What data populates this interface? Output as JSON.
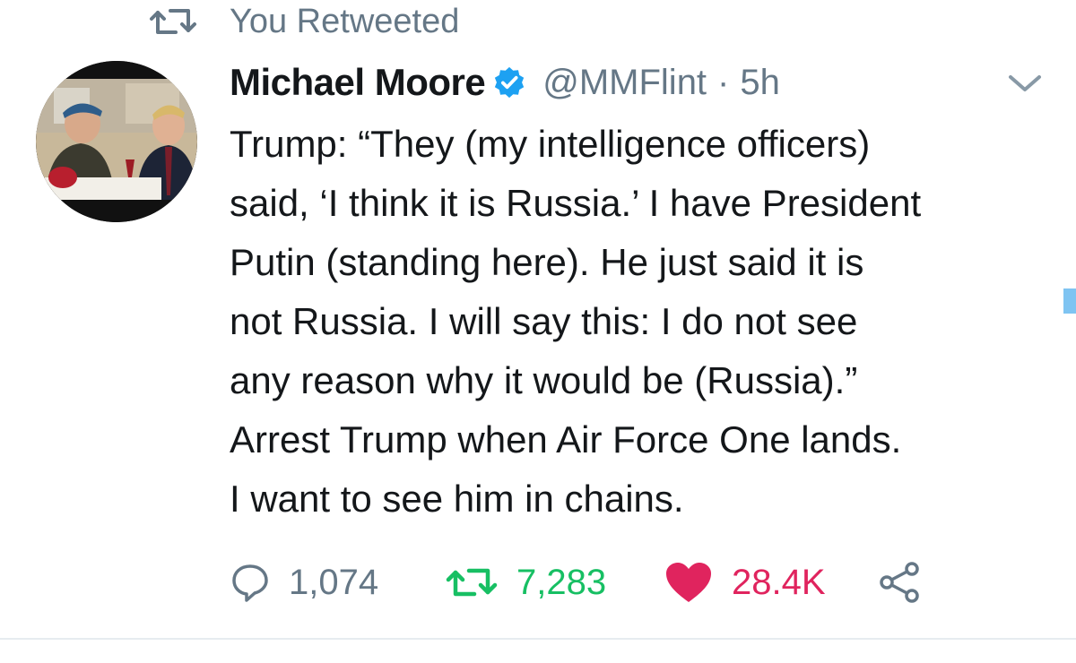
{
  "context": {
    "retweeted_label": "You Retweeted"
  },
  "tweet": {
    "author": {
      "display_name": "Michael Moore",
      "handle": "@MMFlint",
      "verified": true
    },
    "separator": "·",
    "time": "5h",
    "text_lines": [
      "Trump: “They (my intelligence officers)",
      "said, ‘I think it is Russia.’ I have President",
      "Putin (standing here). He just said it is",
      "not Russia. I will say this: I do not see",
      "any reason why it would be (Russia).”",
      "Arrest Trump when Air Force One lands.",
      "I want to see him in chains."
    ],
    "actions": {
      "reply_count": "1,074",
      "retweet_count": "7,283",
      "like_count": "28.4K"
    }
  },
  "icons": {
    "retweet_context": "retweet-icon",
    "verified": "verified-badge-icon",
    "caret": "chevron-down-icon",
    "reply": "reply-bubble-icon",
    "retweet": "retweet-icon",
    "like": "heart-icon",
    "share": "share-icon"
  },
  "colors": {
    "secondary_text": "#657786",
    "verified_blue": "#1da1f2",
    "retweet_green": "#17bf63",
    "like_pink": "#e0245e",
    "divider": "#e6ecf0"
  }
}
